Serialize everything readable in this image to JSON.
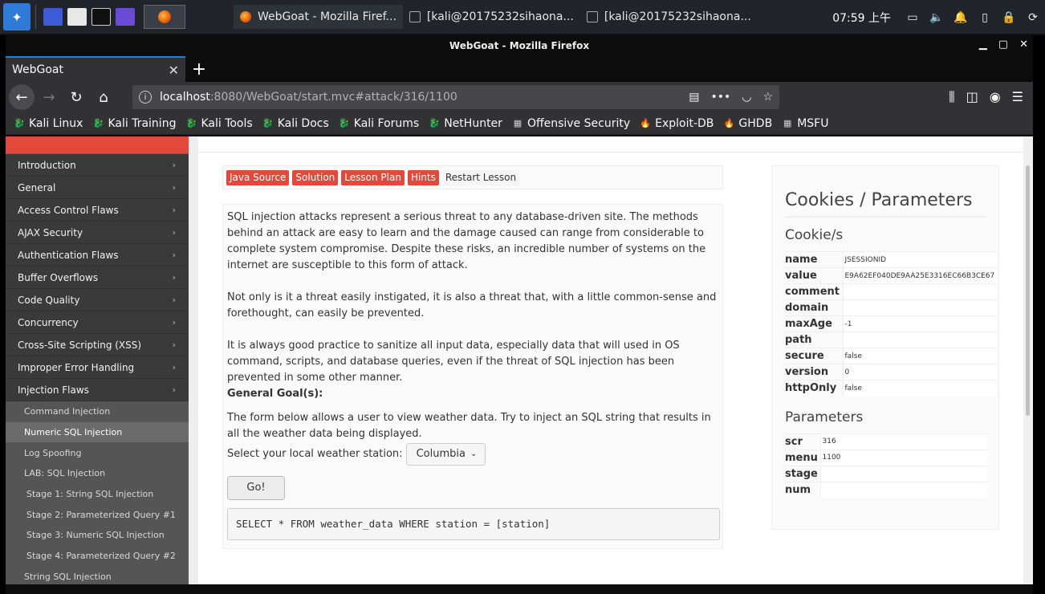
{
  "taskbar": {
    "tasks": [
      {
        "label": "WebGoat - Mozilla Firef...",
        "active": true
      },
      {
        "label": "[kali@20175232sihaona...",
        "active": false
      },
      {
        "label": "[kali@20175232sihaona...",
        "active": false
      }
    ],
    "clock": "07:59 上午"
  },
  "window": {
    "title": "WebGoat - Mozilla Firefox",
    "tab_title": "WebGoat",
    "url_host": "localhost",
    "url_path": ":8080/WebGoat/start.mvc#attack/316/1100"
  },
  "bookmarks": [
    "Kali Linux",
    "Kali Training",
    "Kali Tools",
    "Kali Docs",
    "Kali Forums",
    "NetHunter",
    "Offensive Security",
    "Exploit-DB",
    "GHDB",
    "MSFU"
  ],
  "sidebar": {
    "categories_top": [
      "Introduction",
      "General",
      "Access Control Flaws",
      "AJAX Security",
      "Authentication Flaws",
      "Buffer Overflows",
      "Code Quality",
      "Concurrency",
      "Cross-Site Scripting (XSS)",
      "Improper Error Handling",
      "Injection Flaws"
    ],
    "sub_items": [
      {
        "label": "Command Injection",
        "active": false,
        "stage": false
      },
      {
        "label": "Numeric SQL Injection",
        "active": true,
        "stage": false
      },
      {
        "label": "Log Spoofing",
        "active": false,
        "stage": false
      },
      {
        "label": "LAB: SQL Injection",
        "active": false,
        "stage": false
      },
      {
        "label": "Stage 1: String SQL Injection",
        "active": false,
        "stage": true
      },
      {
        "label": "Stage 2: Parameterized Query #1",
        "active": false,
        "stage": true
      },
      {
        "label": "Stage 3: Numeric SQL Injection",
        "active": false,
        "stage": true
      },
      {
        "label": "Stage 4: Parameterized Query #2",
        "active": false,
        "stage": true
      },
      {
        "label": "String SQL Injection",
        "active": false,
        "stage": false
      }
    ]
  },
  "lesson_buttons": {
    "java_source": "Java Source",
    "solution": "Solution",
    "lesson_plan": "Lesson Plan",
    "hints": "Hints",
    "restart": "Restart Lesson"
  },
  "lesson": {
    "p1": "SQL injection attacks represent a serious threat to any database-driven site. The methods behind an attack are easy to learn and the damage caused can range from considerable to complete system compromise. Despite these risks, an incredible number of systems on the internet are susceptible to this form of attack.",
    "p2": "Not only is it a threat easily instigated, it is also a threat that, with a little common-sense and forethought, can easily be prevented.",
    "p3": "It is always good practice to sanitize all input data, especially data that will used in OS command, scripts, and database queries, even if the threat of SQL injection has been prevented in some other manner.",
    "goal_heading": "General Goal(s):",
    "goal_text": "The form below allows a user to view weather data. Try to inject an SQL string that results in all the weather data being displayed.",
    "station_label": "Select your local weather station:",
    "station_value": "Columbia",
    "go_label": "Go!",
    "sql": "SELECT * FROM weather_data WHERE station = [station]"
  },
  "cookies_panel": {
    "title": "Cookies / Parameters",
    "cookies_heading": "Cookie/s",
    "cookies": [
      {
        "k": "name",
        "v": "JSESSIONID"
      },
      {
        "k": "value",
        "v": "E9A62EF040DE9AA25E3316EC66B3CE67"
      },
      {
        "k": "comment",
        "v": ""
      },
      {
        "k": "domain",
        "v": ""
      },
      {
        "k": "maxAge",
        "v": "-1"
      },
      {
        "k": "path",
        "v": ""
      },
      {
        "k": "secure",
        "v": "false"
      },
      {
        "k": "version",
        "v": "0"
      },
      {
        "k": "httpOnly",
        "v": "false"
      }
    ],
    "params_heading": "Parameters",
    "params": [
      {
        "k": "scr",
        "v": "316"
      },
      {
        "k": "menu",
        "v": "1100"
      },
      {
        "k": "stage",
        "v": ""
      },
      {
        "k": "num",
        "v": ""
      }
    ]
  }
}
